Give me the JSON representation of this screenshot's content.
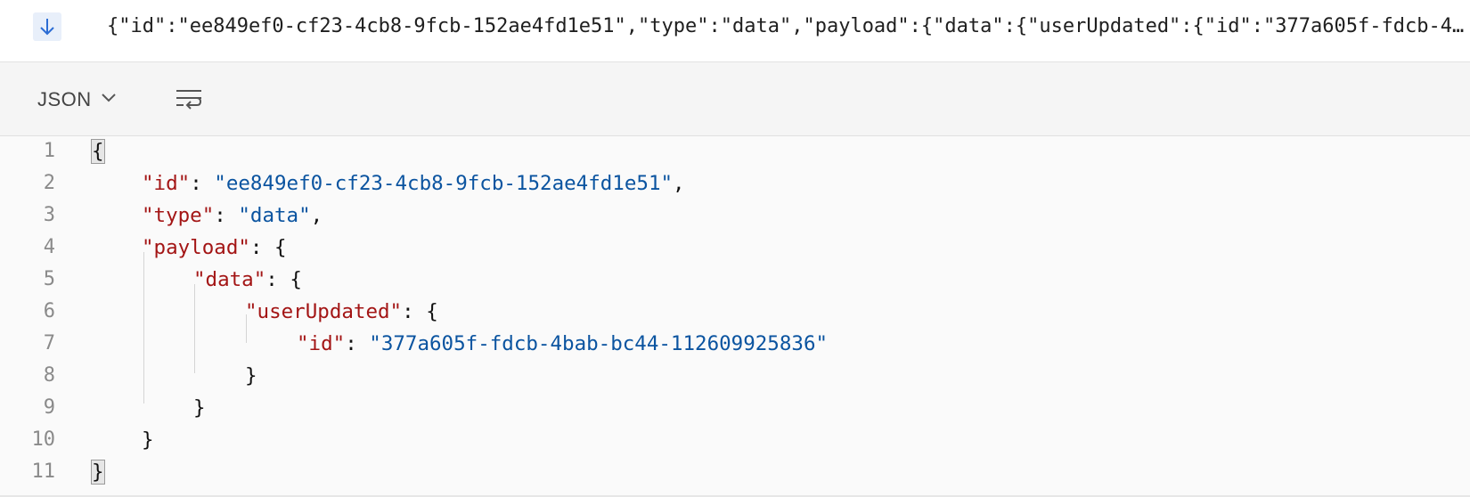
{
  "message": {
    "direction_icon": "arrow-down-icon",
    "raw": "{\"id\":\"ee849ef0-cf23-4cb8-9fcb-152ae4fd1e51\",\"type\":\"data\",\"payload\":{\"data\":{\"userUpdated\":{\"id\":\"377a605f-fdcb-4bab-bc44-112609925836\"}}}}"
  },
  "toolbar": {
    "format_label": "JSON",
    "format_icon": "chevron-down-icon",
    "wrap_icon": "word-wrap-icon"
  },
  "editor": {
    "line_numbers": [
      "1",
      "2",
      "3",
      "4",
      "5",
      "6",
      "7",
      "8",
      "9",
      "10",
      "11"
    ],
    "tokens": {
      "open_brace": "{",
      "close_brace": "}",
      "colon": ": ",
      "comma": ",",
      "id_key": "\"id\"",
      "id_value": "\"ee849ef0-cf23-4cb8-9fcb-152ae4fd1e51\"",
      "type_key": "\"type\"",
      "type_value": "\"data\"",
      "payload_key": "\"payload\"",
      "data_key": "\"data\"",
      "user_updated_key": "\"userUpdated\"",
      "user_id_key": "\"id\"",
      "user_id_value": "\"377a605f-fdcb-4bab-bc44-112609925836\""
    }
  },
  "colors": {
    "key": "#a31515",
    "string": "#0b54a0",
    "direction_bg": "#e8effa",
    "arrow": "#2b6cd4"
  }
}
